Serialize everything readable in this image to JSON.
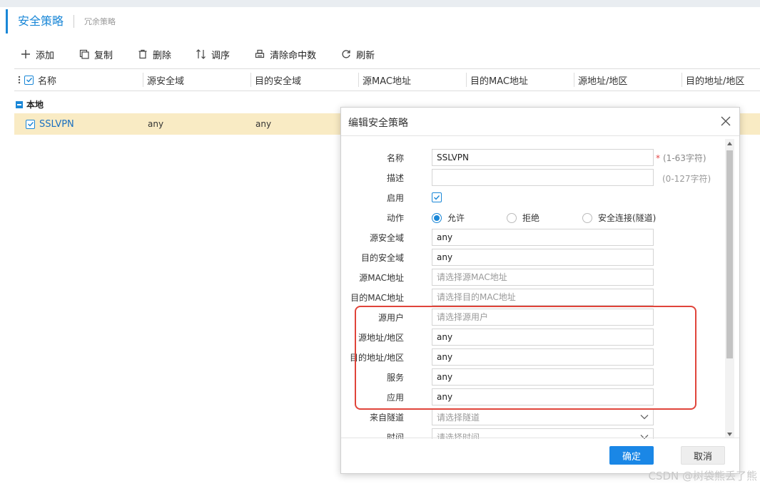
{
  "tabs": {
    "active": "安全策略",
    "inactive": "冗余策略"
  },
  "toolbar": {
    "add": "添加",
    "copy": "复制",
    "delete": "删除",
    "reorder": "调序",
    "clear_hits": "清除命中数",
    "refresh": "刷新"
  },
  "table": {
    "columns": [
      "名称",
      "源安全域",
      "目的安全域",
      "源MAC地址",
      "目的MAC地址",
      "源地址/地区",
      "目的地址/地区"
    ],
    "group": "本地",
    "rows": [
      {
        "name": "SSLVPN",
        "src_zone": "any",
        "dst_zone": "any"
      }
    ]
  },
  "dialog": {
    "title": "编辑安全策略",
    "fields": {
      "name_label": "名称",
      "name_value": "SSLVPN",
      "name_hint": "(1-63字符)",
      "desc_label": "描述",
      "desc_value": "",
      "desc_hint": "(0-127字符)",
      "enable_label": "启用",
      "action_label": "动作",
      "action_allow": "允许",
      "action_deny": "拒绝",
      "action_secure": "安全连接(隧道)",
      "src_zone_label": "源安全域",
      "src_zone_value": "any",
      "dst_zone_label": "目的安全域",
      "dst_zone_value": "any",
      "src_mac_label": "源MAC地址",
      "src_mac_placeholder": "请选择源MAC地址",
      "dst_mac_label": "目的MAC地址",
      "dst_mac_placeholder": "请选择目的MAC地址",
      "src_user_label": "源用户",
      "src_user_placeholder": "请选择源用户",
      "src_addr_label": "源地址/地区",
      "src_addr_value": "any",
      "dst_addr_label": "目的地址/地区",
      "dst_addr_value": "any",
      "service_label": "服务",
      "service_value": "any",
      "app_label": "应用",
      "app_value": "any",
      "tunnel_label": "来自隧道",
      "tunnel_placeholder": "请选择隧道",
      "time_label": "时间",
      "time_placeholder": "请选择时间"
    },
    "ok": "确定",
    "cancel": "取消"
  },
  "watermark": "CSDN @树袋熊丢了熊",
  "colors": {
    "accent": "#1a87d7",
    "row_highlight": "#f9ebc4",
    "annotation": "#e0443a"
  }
}
